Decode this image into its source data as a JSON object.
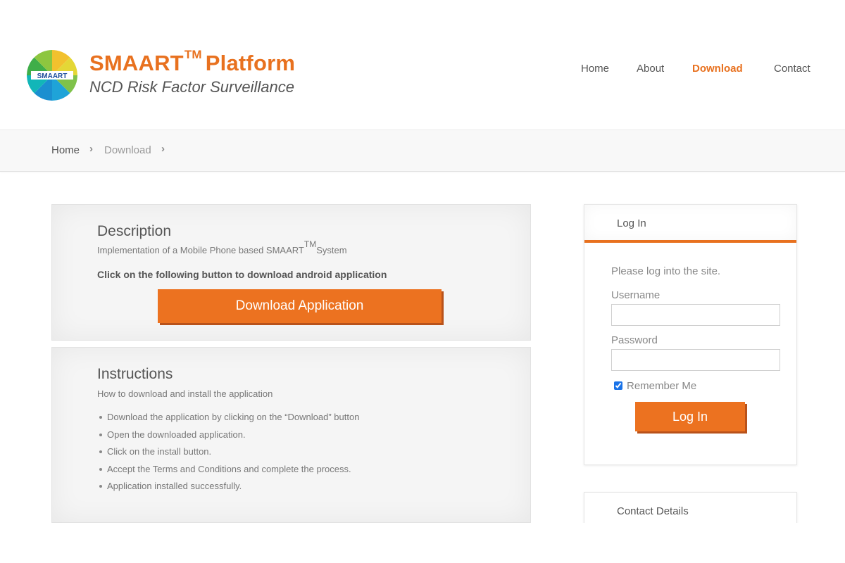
{
  "brand": {
    "title": "SMAART",
    "trademark": "TM",
    "title_suffix": "Platform",
    "subtitle": "NCD Risk Factor Surveillance",
    "logo_text": "SMAART",
    "logo_icon": "smaart-color-wheel-logo"
  },
  "nav": {
    "items": [
      {
        "label": "Home",
        "active": false
      },
      {
        "label": "About",
        "active": false
      },
      {
        "label": "Download",
        "active": true
      },
      {
        "label": "Contact",
        "active": false
      }
    ]
  },
  "breadcrumb": {
    "home": "Home",
    "current": "Download",
    "separator": "›"
  },
  "description": {
    "title": "Description",
    "subtitle_pre": "Implementation of a Mobile Phone based SMAART",
    "subtitle_tm": "TM",
    "subtitle_post": "System",
    "instruction": "Click on the following button to download android application",
    "button_label": "Download Application"
  },
  "instructions": {
    "title": "Instructions",
    "subtitle": "How to download and install the application",
    "steps": [
      "Download the application by clicking on the “Download” button",
      "Open the downloaded application.",
      "Click on the install button.",
      "Accept the Terms and Conditions and complete the process.",
      "Application installed successfully."
    ]
  },
  "login": {
    "heading": "Log In",
    "intro": "Please log into the site.",
    "username_label": "Username",
    "username_value": "",
    "password_label": "Password",
    "password_value": "",
    "remember_label": "Remember Me",
    "remember_checked": true,
    "button_label": "Log In"
  },
  "contact": {
    "heading": "Contact Details"
  },
  "colors": {
    "accent": "#e8711f",
    "button": "#ec7220",
    "button_shadow": "#b9521a"
  }
}
